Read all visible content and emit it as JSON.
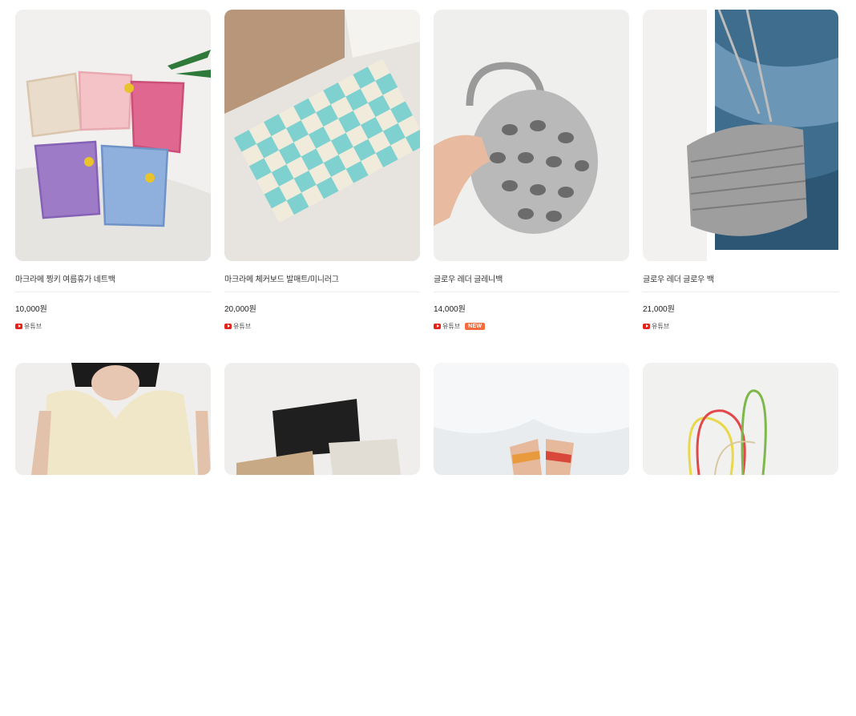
{
  "products": [
    {
      "title": "마크라메 찡키 여름휴가 네트백",
      "price": "10,000원",
      "source": "유튜브",
      "badge": ""
    },
    {
      "title": "마크라메 체커보드 발매트/미니러그",
      "price": "20,000원",
      "source": "유튜브",
      "badge": ""
    },
    {
      "title": "글로우 레더 글레니백",
      "price": "14,000원",
      "source": "유튜브",
      "badge": "NEW"
    },
    {
      "title": "글로우 레더 글로우 백",
      "price": "21,000원",
      "source": "유튜브",
      "badge": ""
    }
  ],
  "colors": {
    "accent_new": "#f26d3d",
    "youtube_red": "#e62117",
    "divider": "#ececec"
  }
}
